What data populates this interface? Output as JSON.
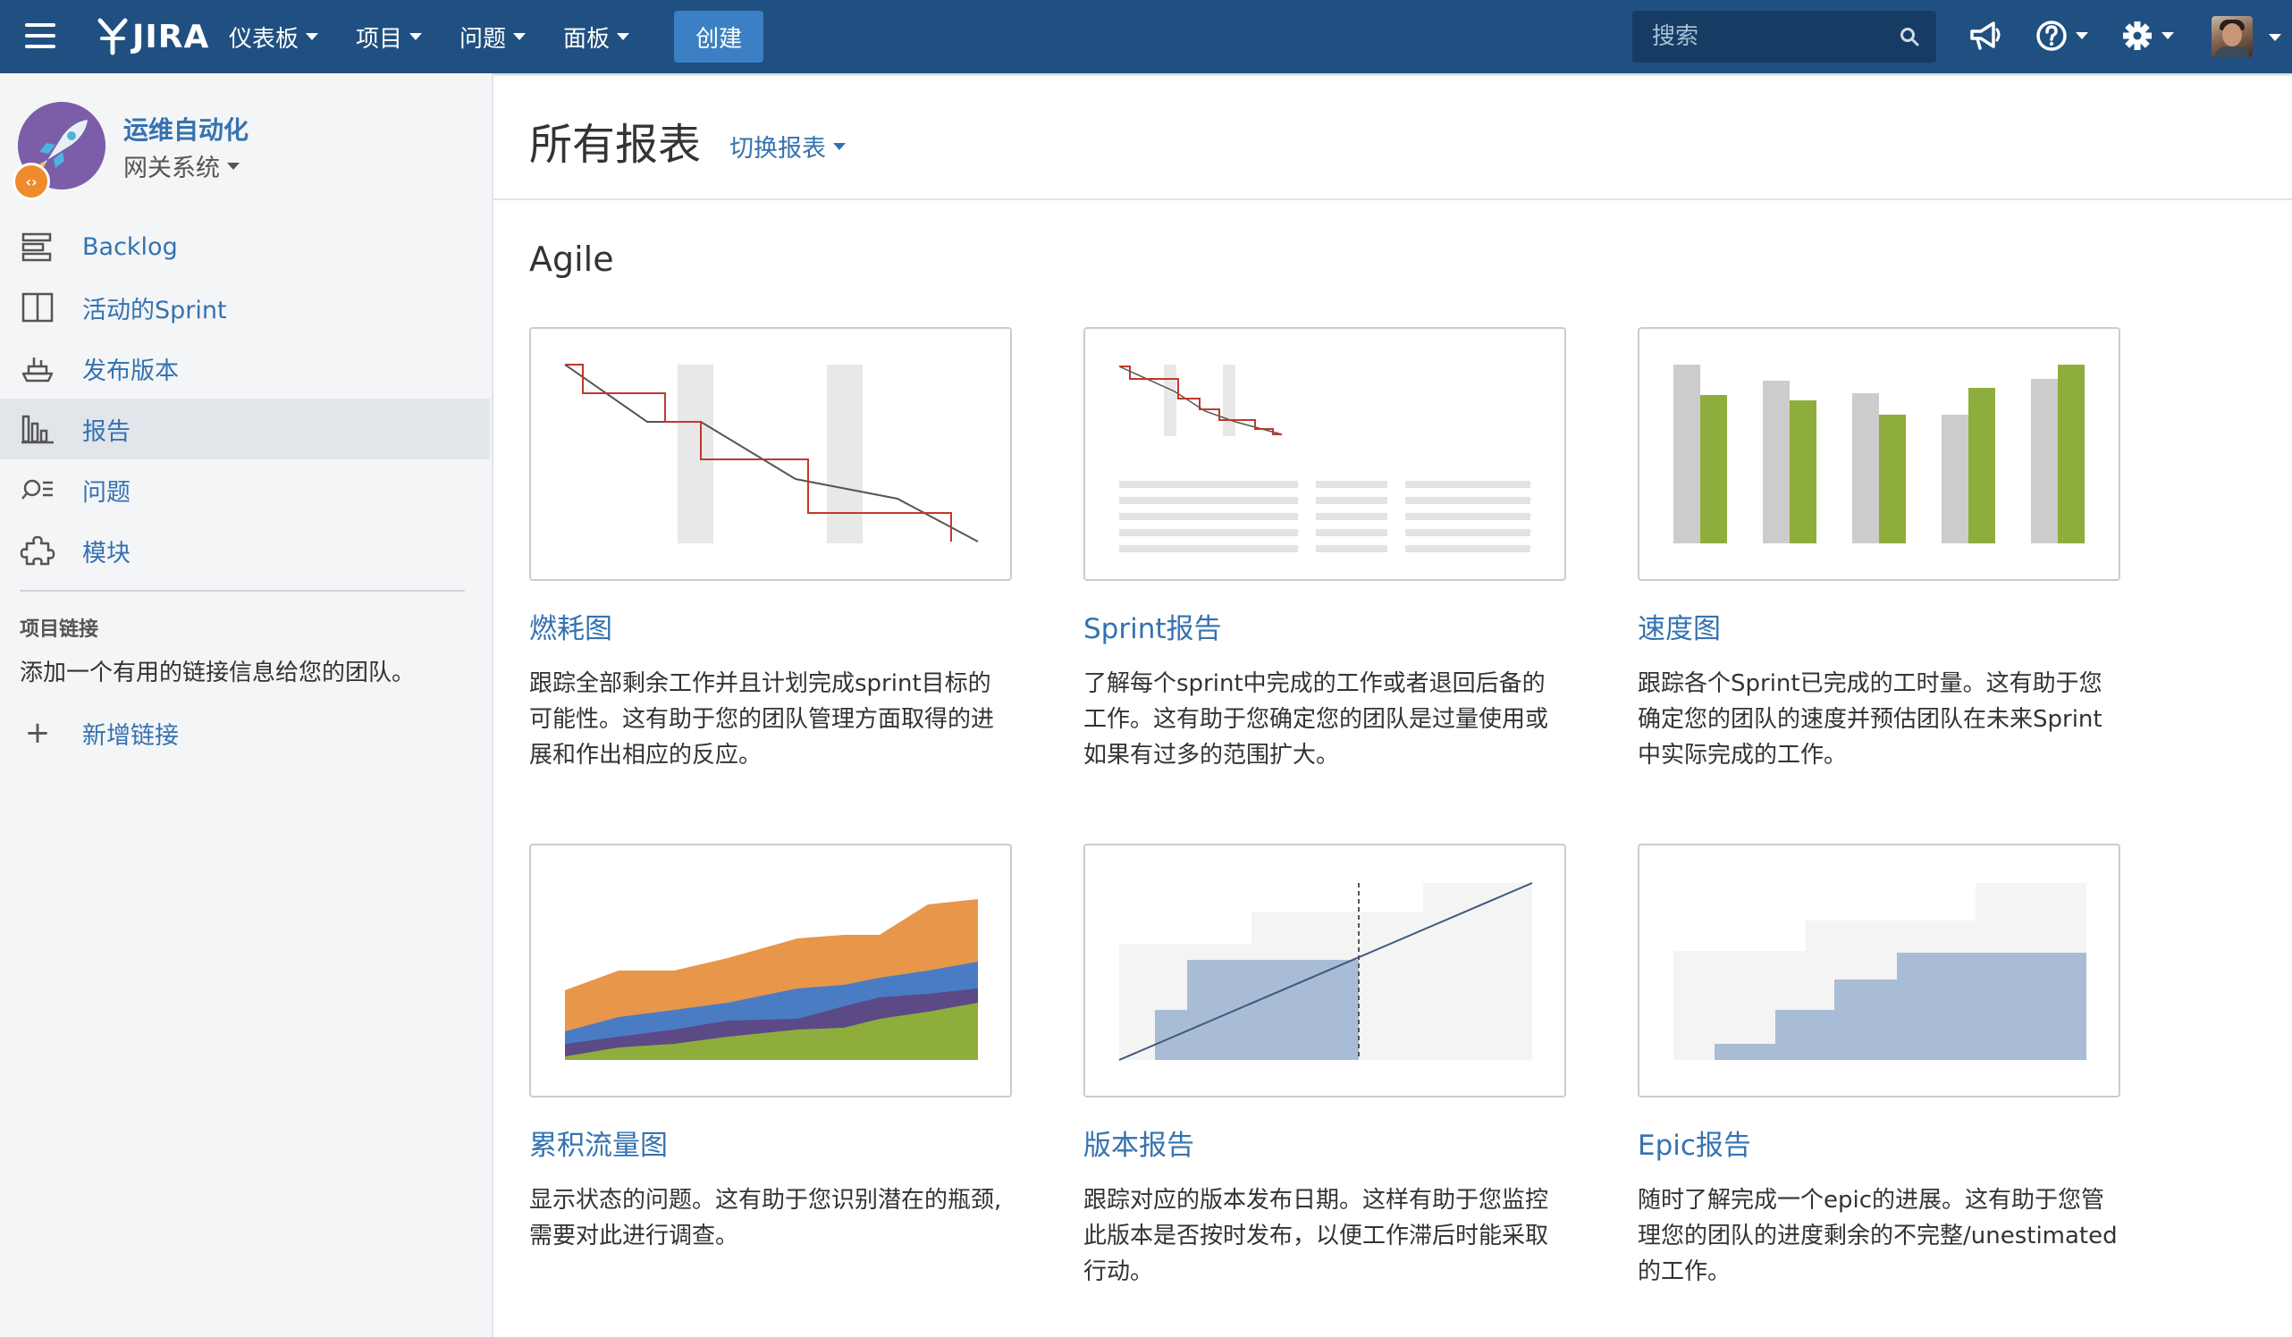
{
  "topnav": {
    "logo": "JIRA",
    "menu": [
      {
        "label": "仪表板"
      },
      {
        "label": "项目"
      },
      {
        "label": "问题"
      },
      {
        "label": "面板"
      }
    ],
    "create_label": "创建",
    "search_placeholder": "搜索"
  },
  "sidebar": {
    "project_name": "运维自动化",
    "project_sub": "网关系统",
    "items": [
      {
        "label": "Backlog"
      },
      {
        "label": "活动的Sprint"
      },
      {
        "label": "发布版本"
      },
      {
        "label": "报告"
      },
      {
        "label": "问题"
      },
      {
        "label": "模块"
      }
    ],
    "links_heading": "项目链接",
    "links_desc": "添加一个有用的链接信息给您的团队。",
    "add_link_label": "新增链接"
  },
  "main": {
    "title": "所有报表",
    "switch_label": "切换报表",
    "section": "Agile",
    "cards": [
      {
        "title": "燃耗图",
        "desc": "跟踪全部剩余工作并且计划完成sprint目标的可能性。这有助于您的团队管理方面取得的进展和作出相应的反应。"
      },
      {
        "title": "Sprint报告",
        "desc": "了解每个sprint中完成的工作或者退回后备的工作。这有助于您确定您的团队是过量使用或如果有过多的范围扩大。"
      },
      {
        "title": "速度图",
        "desc": "跟踪各个Sprint已完成的工时量。这有助于您确定您的团队的速度并预估团队在未来Sprint中实际完成的工作。"
      },
      {
        "title": "累积流量图",
        "desc": "显示状态的问题。这有助于您识别潜在的瓶颈, 需要对此进行调查。"
      },
      {
        "title": "版本报告",
        "desc": "跟踪对应的版本发布日期。这样有助于您监控此版本是否按时发布，以便工作滞后时能采取行动。"
      },
      {
        "title": "Epic报告",
        "desc": "随时了解完成一个epic的进展。这有助于您管理您的团队的进度剩余的不完整/unestimated 的工作。"
      }
    ]
  },
  "colors": {
    "nav": "#205081",
    "link": "#3572b0",
    "accent_red": "#c0392b",
    "green": "#8fad3c",
    "orange": "#e8964a",
    "blue": "#4a7cc4",
    "purple": "#5b4a86",
    "steel": "#a9bcd6"
  }
}
